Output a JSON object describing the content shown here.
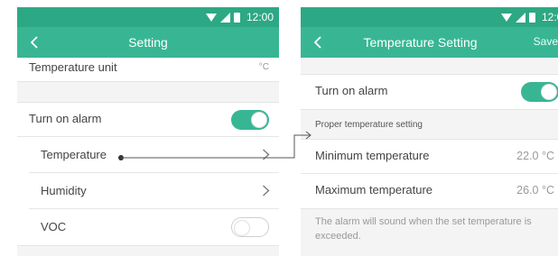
{
  "status_time": "12:00",
  "left_screen": {
    "title": "Setting",
    "temperature_unit": {
      "label": "Temperature unit",
      "value": "°C"
    },
    "turn_on_alarm": {
      "label": "Turn on alarm",
      "enabled": true
    },
    "items": [
      {
        "label": "Temperature",
        "control": "chevron"
      },
      {
        "label": "Humidity",
        "control": "chevron"
      },
      {
        "label": "VOC",
        "control": "toggle",
        "enabled": false
      }
    ]
  },
  "right_screen": {
    "title": "Temperature Setting",
    "save_label": "Save",
    "turn_on_alarm": {
      "label": "Turn on alarm",
      "enabled": true
    },
    "section_header": "Proper temperature setting",
    "min": {
      "label": "Minimum temperature",
      "value": "22.0 °C"
    },
    "max": {
      "label": "Maximum temperature",
      "value": "26.0 °C"
    },
    "footnote": "The alarm will sound when the set temperature is exceeded."
  },
  "colors": {
    "statusbar": "#2da884",
    "appbar": "#38b694",
    "toggle_on": "#38b694",
    "background": "#f4f4f4"
  }
}
